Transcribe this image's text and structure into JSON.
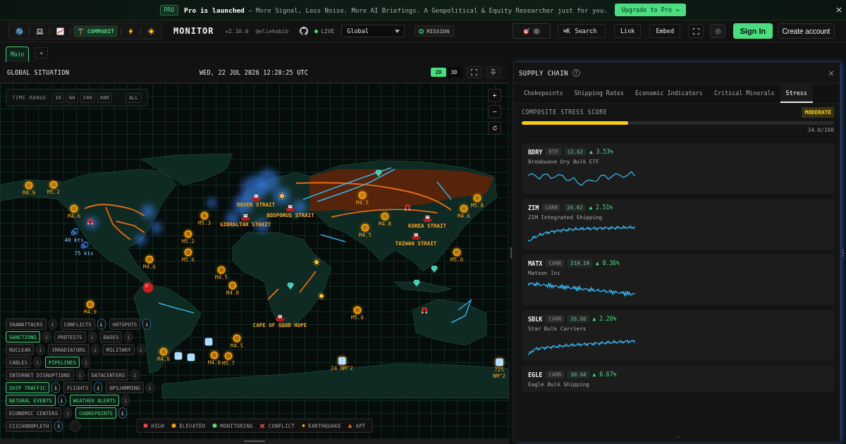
{
  "banner": {
    "badge": "PRO",
    "message": "**Pro is launched** – More Signal, Less Noise. More AI Briefings. A Geopolitical & Equity Researcher just for you.",
    "upgrade_button": "Upgrade to Pro →"
  },
  "header": {
    "view_variants": [
      {
        "selected": false
      },
      {
        "selected": false
      },
      {
        "selected": false
      },
      {
        "label": "COMMODIT",
        "selected": true
      },
      {
        "selected": false
      },
      {
        "selected": false
      }
    ],
    "title": "MONITOR",
    "version": "v2.10.0",
    "author": "@eliehabib",
    "live": {
      "label": "LIVE",
      "on": true
    },
    "region_select": {
      "value": "Global"
    },
    "mission_button": "MISSION",
    "alerts": {
      "count": "0"
    },
    "search": {
      "shortcut": "⌘K",
      "label": "Search"
    },
    "buttons": [
      "Link",
      "Embed"
    ],
    "sign_in": "Sign In",
    "create_account": "Create account"
  },
  "workspace_tabs": {
    "tabs": [
      {
        "label": "Main",
        "selected": true
      }
    ],
    "add": "+"
  },
  "map_panel": {
    "title": "GLOBAL SITUATION",
    "datetime": "WED, 22 JUL 2026 12:28:25 UTC",
    "view_modes": [
      {
        "label": "2D",
        "selected": true
      },
      {
        "label": "3D",
        "selected": false
      }
    ],
    "time_range": {
      "label": "TIME RANGE",
      "options": [
        {
          "label": "1H",
          "selected": false
        },
        {
          "label": "6H",
          "selected": false
        },
        {
          "label": "24H",
          "selected": false
        },
        {
          "label": "48H",
          "selected": false
        },
        {
          "label": "ALL",
          "selected": false
        }
      ]
    },
    "zoom_controls": [
      "+",
      "−"
    ],
    "markers": [
      {
        "kind": "quake",
        "label": "M4.9"
      },
      {
        "kind": "quake",
        "label": "M5.2"
      },
      {
        "kind": "strait",
        "label": "DOVER STRAIT"
      },
      {
        "kind": "quake",
        "label": "M4.5"
      },
      {
        "kind": "quake",
        "label": "M5.8"
      },
      {
        "kind": "quake",
        "label": "M4.6"
      },
      {
        "kind": "strait",
        "label": "BOSPORUS STRAIT"
      },
      {
        "kind": "quake",
        "label": "M4.6"
      },
      {
        "kind": "quake",
        "label": "M5.3"
      },
      {
        "kind": "strait",
        "label": "GIBRALTAR STRAIT"
      },
      {
        "kind": "quake",
        "label": "M4.8"
      },
      {
        "kind": "strait",
        "label": "KOREA STRAIT"
      },
      {
        "kind": "storm",
        "label": "40 kts"
      },
      {
        "kind": "quake",
        "label": "M5.2"
      },
      {
        "kind": "quake",
        "label": "M4.5"
      },
      {
        "kind": "strait",
        "label": "TAIWAN STRAIT"
      },
      {
        "kind": "storm",
        "label": "75 kts"
      },
      {
        "kind": "quake",
        "label": "M5.6"
      },
      {
        "kind": "quake",
        "label": "M5.0"
      },
      {
        "kind": "quake",
        "label": "M4.6"
      },
      {
        "kind": "quake",
        "label": "M4.5"
      },
      {
        "kind": "quake",
        "label": "M4.8"
      },
      {
        "kind": "quake",
        "label": "M4.9"
      },
      {
        "kind": "quake",
        "label": "M5.0"
      },
      {
        "kind": "strait",
        "label": "CAPE OF GOOD HOPE"
      },
      {
        "kind": "quake",
        "label": "M4.5"
      },
      {
        "kind": "quake",
        "label": "M4.8"
      },
      {
        "kind": "quake",
        "label": "M4.8"
      },
      {
        "kind": "quake",
        "label": "M5.7"
      },
      {
        "kind": "ice",
        "label": "24 NM^2"
      },
      {
        "kind": "ice",
        "label": "725 NM^2"
      }
    ],
    "layer_rows": [
      [
        {
          "label": "IRANATTACKS",
          "on": false,
          "info": "i",
          "info_highlighted": false
        },
        {
          "label": "CONFLICTS",
          "on": false,
          "info": "i",
          "info_highlighted": true
        },
        {
          "label": "HOTSPOTS",
          "on": false,
          "info": "i",
          "info_highlighted": true
        }
      ],
      [
        {
          "label": "SANCTIONS",
          "on": true,
          "info": "i",
          "info_highlighted": false
        },
        {
          "label": "PROTESTS",
          "on": false,
          "info": "i",
          "info_highlighted": false
        },
        {
          "label": "BASES",
          "on": false,
          "info": "i",
          "info_highlighted": false
        }
      ],
      [
        {
          "label": "NUCLEAR",
          "on": false,
          "info": "i",
          "info_highlighted": false
        },
        {
          "label": "IRRADIATORS",
          "on": false,
          "info": "i",
          "info_highlighted": false
        },
        {
          "label": "MILITARY",
          "on": false,
          "info": "i",
          "info_highlighted": false
        }
      ],
      [
        {
          "label": "CABLES",
          "on": false,
          "info": "i",
          "info_highlighted": false
        },
        {
          "label": "PIPELINES",
          "on": true,
          "info": "i",
          "info_highlighted": false
        }
      ],
      [
        {
          "label": "INTERNET DISRUPTIONS",
          "on": false,
          "info": "i",
          "info_highlighted": false
        },
        {
          "label": "DATACENTERS",
          "on": false,
          "info": "i",
          "info_highlighted": false
        }
      ],
      [
        {
          "label": "SHIP TRAFFIC",
          "on": true,
          "info": "i",
          "info_highlighted": true
        },
        {
          "label": "FLIGHTS",
          "on": false,
          "info": "i",
          "info_highlighted": true
        },
        {
          "label": "GPSJAMMING",
          "on": false,
          "info": "i",
          "info_highlighted": false
        }
      ],
      [
        {
          "label": "NATURAL EVENTS",
          "on": true,
          "info": "i",
          "info_highlighted": true
        },
        {
          "label": "WEATHER ALERTS",
          "on": true,
          "info": "i",
          "info_highlighted": false
        }
      ],
      [
        {
          "label": "ECONOMIC CENTERS",
          "on": false,
          "info": "i",
          "info_highlighted": false
        },
        {
          "label": "CHOKEPOINTS",
          "on": true,
          "info": "i",
          "info_highlighted": true
        }
      ],
      [
        {
          "label": "CIICHOROPLETH",
          "on": false,
          "info": "i",
          "info_highlighted": true
        }
      ]
    ],
    "legend": [
      {
        "label": "HIGH",
        "kind": "dot",
        "color": "#ef4444"
      },
      {
        "label": "ELEVATED",
        "kind": "dot",
        "color": "#f59e0b"
      },
      {
        "label": "MONITORING",
        "kind": "dot",
        "color": "#4ade80"
      },
      {
        "label": "CONFLICT",
        "kind": "cross",
        "color": "#ef4444"
      },
      {
        "label": "EARTHQUAKE",
        "kind": "pip",
        "color": "#f5a524"
      },
      {
        "label": "APT",
        "kind": "triangle",
        "color": "#f97316"
      }
    ]
  },
  "supply_panel": {
    "title": "SUPPLY CHAIN",
    "help": "?",
    "tabs": [
      {
        "label": "Chokepoints",
        "selected": false
      },
      {
        "label": "Shipping Rates",
        "selected": false
      },
      {
        "label": "Economic Indicators",
        "selected": false
      },
      {
        "label": "Critical Minerals",
        "selected": false
      },
      {
        "label": "Stress",
        "selected": true
      }
    ],
    "stress": {
      "label": "COMPOSITE STRESS SCORE",
      "status": "MODERATE",
      "level": 0.34,
      "reading": "34.0/100"
    },
    "securities": [
      {
        "ticker": "BDRY",
        "type": "ETF",
        "price": "12.62",
        "change": "▲ 3.53%",
        "name": "Breakwave Dry Bulk ETF",
        "sparkline": true
      },
      {
        "ticker": "ZIM",
        "type": "CARR",
        "price": "24.92",
        "change": "▲ 2.51%",
        "name": "ZIM Integrated Shipping",
        "sparkline": true
      },
      {
        "ticker": "MATX",
        "type": "CARR",
        "price": "219.19",
        "change": "▲ 0.36%",
        "name": "Matson Inc",
        "sparkline": true
      },
      {
        "ticker": "SBLK",
        "type": "CARR",
        "price": "26.68",
        "change": "▲ 2.26%",
        "name": "Star Bulk Carriers",
        "sparkline": true
      },
      {
        "ticker": "EGLE",
        "type": "CARR",
        "price": "30.84",
        "change": "▲ 0.67%",
        "name": "Eagle Bulk Shipping",
        "sparkline": false
      }
    ]
  }
}
